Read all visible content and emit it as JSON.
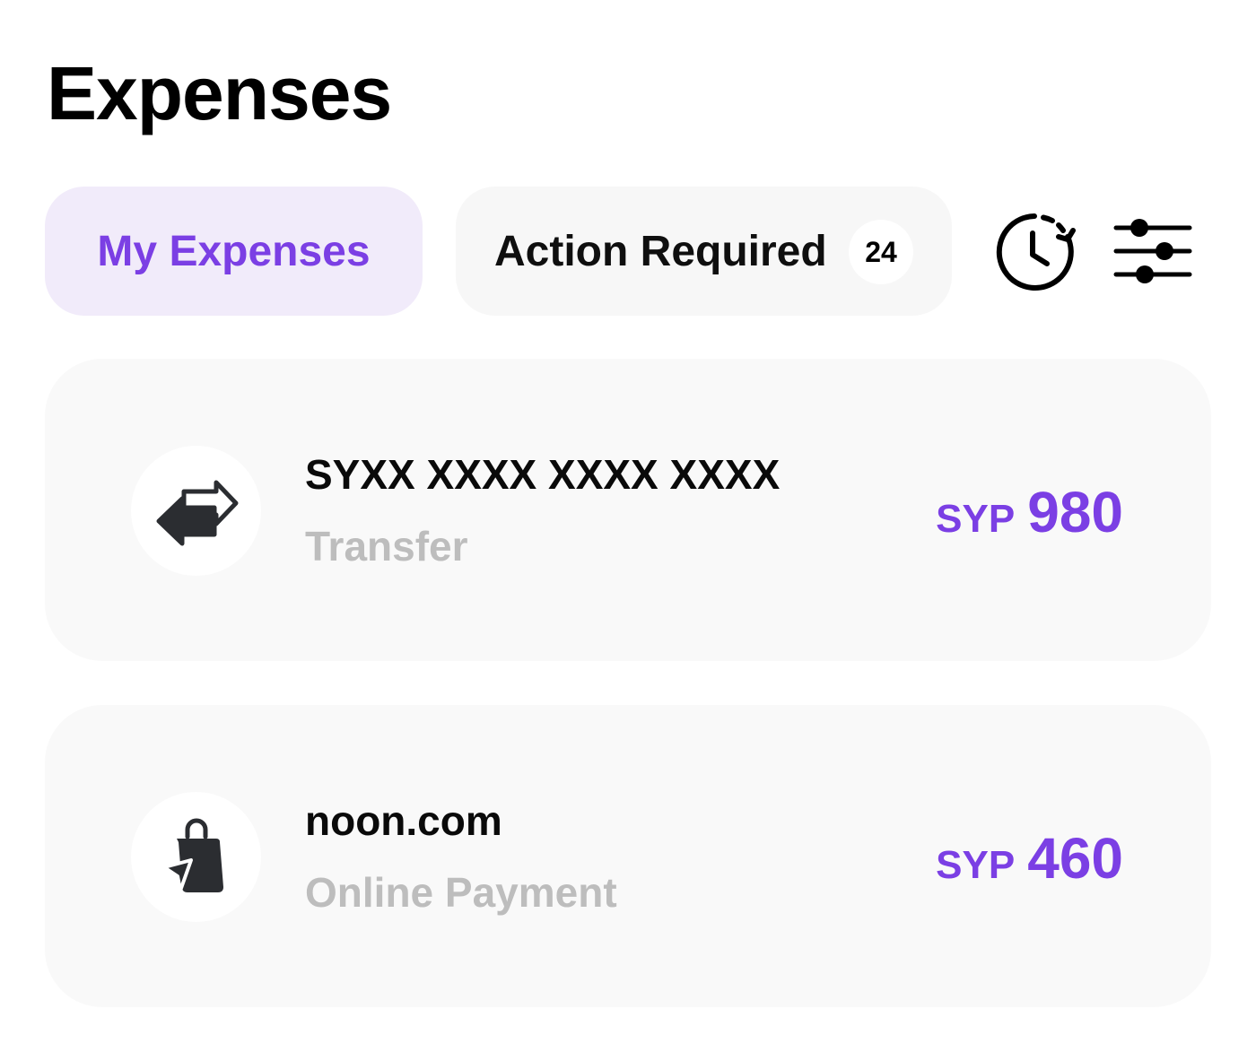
{
  "header": {
    "title": "Expenses"
  },
  "tabs": {
    "my_expenses": "My Expenses",
    "action_required": "Action Required",
    "action_required_count": "24"
  },
  "toolbar": {
    "history_icon": "clock-history-icon",
    "filter_icon": "sliders-filter-icon"
  },
  "colors": {
    "accent": "#7b3fe4",
    "active_tab_bg": "#f1ebfa",
    "card_bg": "#f9f9f9",
    "muted_text": "#bdbdbd"
  },
  "expenses": [
    {
      "title": "SYXX XXXX XXXX XXXX",
      "subtitle": "Transfer",
      "currency": "SYP",
      "amount": "980",
      "icon": "transfer-arrows-icon"
    },
    {
      "title": "noon.com",
      "subtitle": "Online Payment",
      "currency": "SYP",
      "amount": "460",
      "icon": "shopping-bag-icon"
    }
  ]
}
